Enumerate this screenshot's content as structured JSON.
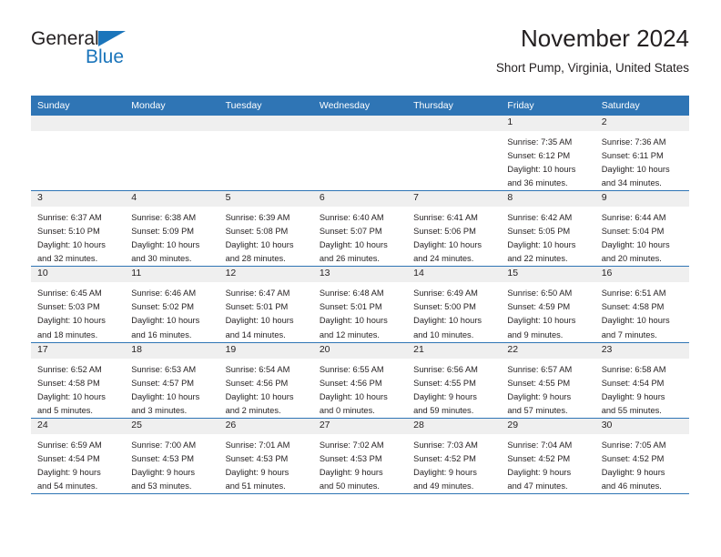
{
  "brand": {
    "name_part1": "General",
    "name_part2": "Blue",
    "accent_color": "#1b75bb"
  },
  "header": {
    "title": "November 2024",
    "subtitle": "Short Pump, Virginia, United States"
  },
  "theme": {
    "header_blue": "#2f75b5",
    "daynum_band": "#efefef",
    "text": "#231f20"
  },
  "weekdays": [
    "Sunday",
    "Monday",
    "Tuesday",
    "Wednesday",
    "Thursday",
    "Friday",
    "Saturday"
  ],
  "weeks": [
    [
      {
        "day": "",
        "sunrise": "",
        "sunset": "",
        "daylight_line1": "",
        "daylight_line2": "",
        "empty": true
      },
      {
        "day": "",
        "sunrise": "",
        "sunset": "",
        "daylight_line1": "",
        "daylight_line2": "",
        "empty": true
      },
      {
        "day": "",
        "sunrise": "",
        "sunset": "",
        "daylight_line1": "",
        "daylight_line2": "",
        "empty": true
      },
      {
        "day": "",
        "sunrise": "",
        "sunset": "",
        "daylight_line1": "",
        "daylight_line2": "",
        "empty": true
      },
      {
        "day": "",
        "sunrise": "",
        "sunset": "",
        "daylight_line1": "",
        "daylight_line2": "",
        "empty": true
      },
      {
        "day": "1",
        "sunrise": "Sunrise: 7:35 AM",
        "sunset": "Sunset: 6:12 PM",
        "daylight_line1": "Daylight: 10 hours",
        "daylight_line2": "and 36 minutes.",
        "empty": false
      },
      {
        "day": "2",
        "sunrise": "Sunrise: 7:36 AM",
        "sunset": "Sunset: 6:11 PM",
        "daylight_line1": "Daylight: 10 hours",
        "daylight_line2": "and 34 minutes.",
        "empty": false
      }
    ],
    [
      {
        "day": "3",
        "sunrise": "Sunrise: 6:37 AM",
        "sunset": "Sunset: 5:10 PM",
        "daylight_line1": "Daylight: 10 hours",
        "daylight_line2": "and 32 minutes.",
        "empty": false
      },
      {
        "day": "4",
        "sunrise": "Sunrise: 6:38 AM",
        "sunset": "Sunset: 5:09 PM",
        "daylight_line1": "Daylight: 10 hours",
        "daylight_line2": "and 30 minutes.",
        "empty": false
      },
      {
        "day": "5",
        "sunrise": "Sunrise: 6:39 AM",
        "sunset": "Sunset: 5:08 PM",
        "daylight_line1": "Daylight: 10 hours",
        "daylight_line2": "and 28 minutes.",
        "empty": false
      },
      {
        "day": "6",
        "sunrise": "Sunrise: 6:40 AM",
        "sunset": "Sunset: 5:07 PM",
        "daylight_line1": "Daylight: 10 hours",
        "daylight_line2": "and 26 minutes.",
        "empty": false
      },
      {
        "day": "7",
        "sunrise": "Sunrise: 6:41 AM",
        "sunset": "Sunset: 5:06 PM",
        "daylight_line1": "Daylight: 10 hours",
        "daylight_line2": "and 24 minutes.",
        "empty": false
      },
      {
        "day": "8",
        "sunrise": "Sunrise: 6:42 AM",
        "sunset": "Sunset: 5:05 PM",
        "daylight_line1": "Daylight: 10 hours",
        "daylight_line2": "and 22 minutes.",
        "empty": false
      },
      {
        "day": "9",
        "sunrise": "Sunrise: 6:44 AM",
        "sunset": "Sunset: 5:04 PM",
        "daylight_line1": "Daylight: 10 hours",
        "daylight_line2": "and 20 minutes.",
        "empty": false
      }
    ],
    [
      {
        "day": "10",
        "sunrise": "Sunrise: 6:45 AM",
        "sunset": "Sunset: 5:03 PM",
        "daylight_line1": "Daylight: 10 hours",
        "daylight_line2": "and 18 minutes.",
        "empty": false
      },
      {
        "day": "11",
        "sunrise": "Sunrise: 6:46 AM",
        "sunset": "Sunset: 5:02 PM",
        "daylight_line1": "Daylight: 10 hours",
        "daylight_line2": "and 16 minutes.",
        "empty": false
      },
      {
        "day": "12",
        "sunrise": "Sunrise: 6:47 AM",
        "sunset": "Sunset: 5:01 PM",
        "daylight_line1": "Daylight: 10 hours",
        "daylight_line2": "and 14 minutes.",
        "empty": false
      },
      {
        "day": "13",
        "sunrise": "Sunrise: 6:48 AM",
        "sunset": "Sunset: 5:01 PM",
        "daylight_line1": "Daylight: 10 hours",
        "daylight_line2": "and 12 minutes.",
        "empty": false
      },
      {
        "day": "14",
        "sunrise": "Sunrise: 6:49 AM",
        "sunset": "Sunset: 5:00 PM",
        "daylight_line1": "Daylight: 10 hours",
        "daylight_line2": "and 10 minutes.",
        "empty": false
      },
      {
        "day": "15",
        "sunrise": "Sunrise: 6:50 AM",
        "sunset": "Sunset: 4:59 PM",
        "daylight_line1": "Daylight: 10 hours",
        "daylight_line2": "and 9 minutes.",
        "empty": false
      },
      {
        "day": "16",
        "sunrise": "Sunrise: 6:51 AM",
        "sunset": "Sunset: 4:58 PM",
        "daylight_line1": "Daylight: 10 hours",
        "daylight_line2": "and 7 minutes.",
        "empty": false
      }
    ],
    [
      {
        "day": "17",
        "sunrise": "Sunrise: 6:52 AM",
        "sunset": "Sunset: 4:58 PM",
        "daylight_line1": "Daylight: 10 hours",
        "daylight_line2": "and 5 minutes.",
        "empty": false
      },
      {
        "day": "18",
        "sunrise": "Sunrise: 6:53 AM",
        "sunset": "Sunset: 4:57 PM",
        "daylight_line1": "Daylight: 10 hours",
        "daylight_line2": "and 3 minutes.",
        "empty": false
      },
      {
        "day": "19",
        "sunrise": "Sunrise: 6:54 AM",
        "sunset": "Sunset: 4:56 PM",
        "daylight_line1": "Daylight: 10 hours",
        "daylight_line2": "and 2 minutes.",
        "empty": false
      },
      {
        "day": "20",
        "sunrise": "Sunrise: 6:55 AM",
        "sunset": "Sunset: 4:56 PM",
        "daylight_line1": "Daylight: 10 hours",
        "daylight_line2": "and 0 minutes.",
        "empty": false
      },
      {
        "day": "21",
        "sunrise": "Sunrise: 6:56 AM",
        "sunset": "Sunset: 4:55 PM",
        "daylight_line1": "Daylight: 9 hours",
        "daylight_line2": "and 59 minutes.",
        "empty": false
      },
      {
        "day": "22",
        "sunrise": "Sunrise: 6:57 AM",
        "sunset": "Sunset: 4:55 PM",
        "daylight_line1": "Daylight: 9 hours",
        "daylight_line2": "and 57 minutes.",
        "empty": false
      },
      {
        "day": "23",
        "sunrise": "Sunrise: 6:58 AM",
        "sunset": "Sunset: 4:54 PM",
        "daylight_line1": "Daylight: 9 hours",
        "daylight_line2": "and 55 minutes.",
        "empty": false
      }
    ],
    [
      {
        "day": "24",
        "sunrise": "Sunrise: 6:59 AM",
        "sunset": "Sunset: 4:54 PM",
        "daylight_line1": "Daylight: 9 hours",
        "daylight_line2": "and 54 minutes.",
        "empty": false
      },
      {
        "day": "25",
        "sunrise": "Sunrise: 7:00 AM",
        "sunset": "Sunset: 4:53 PM",
        "daylight_line1": "Daylight: 9 hours",
        "daylight_line2": "and 53 minutes.",
        "empty": false
      },
      {
        "day": "26",
        "sunrise": "Sunrise: 7:01 AM",
        "sunset": "Sunset: 4:53 PM",
        "daylight_line1": "Daylight: 9 hours",
        "daylight_line2": "and 51 minutes.",
        "empty": false
      },
      {
        "day": "27",
        "sunrise": "Sunrise: 7:02 AM",
        "sunset": "Sunset: 4:53 PM",
        "daylight_line1": "Daylight: 9 hours",
        "daylight_line2": "and 50 minutes.",
        "empty": false
      },
      {
        "day": "28",
        "sunrise": "Sunrise: 7:03 AM",
        "sunset": "Sunset: 4:52 PM",
        "daylight_line1": "Daylight: 9 hours",
        "daylight_line2": "and 49 minutes.",
        "empty": false
      },
      {
        "day": "29",
        "sunrise": "Sunrise: 7:04 AM",
        "sunset": "Sunset: 4:52 PM",
        "daylight_line1": "Daylight: 9 hours",
        "daylight_line2": "and 47 minutes.",
        "empty": false
      },
      {
        "day": "30",
        "sunrise": "Sunrise: 7:05 AM",
        "sunset": "Sunset: 4:52 PM",
        "daylight_line1": "Daylight: 9 hours",
        "daylight_line2": "and 46 minutes.",
        "empty": false
      }
    ]
  ]
}
